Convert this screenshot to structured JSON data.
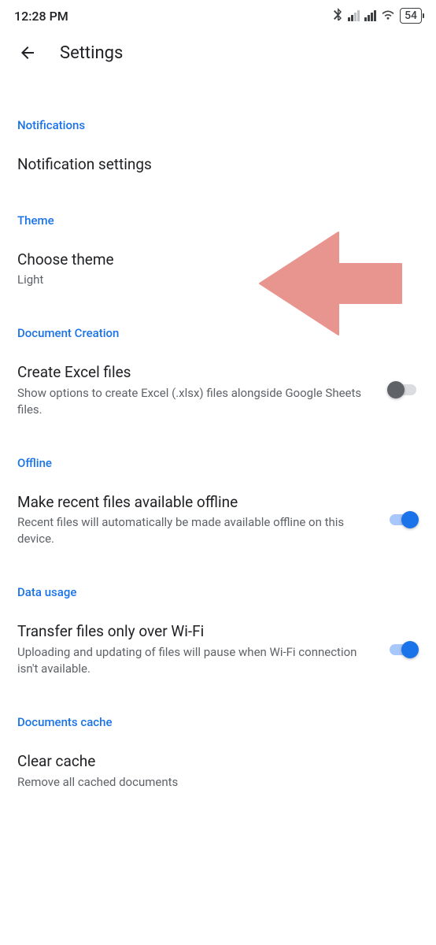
{
  "statusBar": {
    "time": "12:28 PM",
    "batteryLevel": "54"
  },
  "header": {
    "title": "Settings"
  },
  "sections": {
    "notifications": {
      "header": "Notifications",
      "item": {
        "title": "Notification settings"
      }
    },
    "theme": {
      "header": "Theme",
      "item": {
        "title": "Choose theme",
        "subtitle": "Light"
      }
    },
    "documentCreation": {
      "header": "Document Creation",
      "item": {
        "title": "Create Excel files",
        "subtitle": "Show options to create Excel (.xlsx) files alongside Google Sheets files.",
        "toggleOn": false
      }
    },
    "offline": {
      "header": "Offline",
      "item": {
        "title": "Make recent files available offline",
        "subtitle": "Recent files will automatically be made available offline on this device.",
        "toggleOn": true
      }
    },
    "dataUsage": {
      "header": "Data usage",
      "item": {
        "title": "Transfer files only over Wi-Fi",
        "subtitle": "Uploading and updating of files will pause when Wi-Fi connection isn't available.",
        "toggleOn": true
      }
    },
    "documentsCache": {
      "header": "Documents cache",
      "item": {
        "title": "Clear cache",
        "subtitle": "Remove all cached documents"
      }
    }
  }
}
